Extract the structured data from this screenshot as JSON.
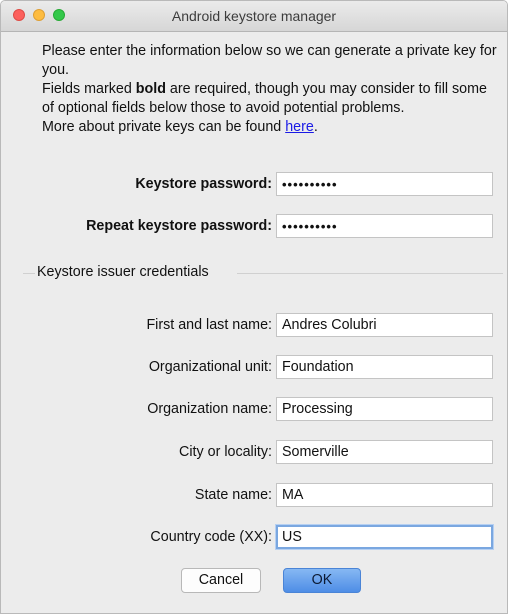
{
  "window": {
    "title": "Android keystore manager"
  },
  "intro": {
    "line1": "Please enter the information below so we can generate a private key for you.",
    "line2_pre": "Fields marked ",
    "line2_bold": "bold",
    "line2_post": " are required, though you may consider to fill some of optional fields below those to avoid potential problems.",
    "line3_pre": "More about private keys can be found ",
    "line3_link": "here",
    "line3_post": "."
  },
  "password": {
    "keystore_label": "Keystore password:",
    "keystore_value": "••••••••••",
    "repeat_label": "Repeat keystore password:",
    "repeat_value": "••••••••••"
  },
  "section": {
    "label": "Keystore issuer credentials"
  },
  "fields": {
    "name_label": "First and last name:",
    "name_value": "Andres Colubri",
    "unit_label": "Organizational unit:",
    "unit_value": "Foundation",
    "org_label": "Organization name:",
    "org_value": "Processing",
    "city_label": "City or locality:",
    "city_value": "Somerville",
    "state_label": "State name:",
    "state_value": "MA",
    "country_label": "Country code (XX):",
    "country_value": "US"
  },
  "buttons": {
    "cancel": "Cancel",
    "ok": "OK"
  }
}
